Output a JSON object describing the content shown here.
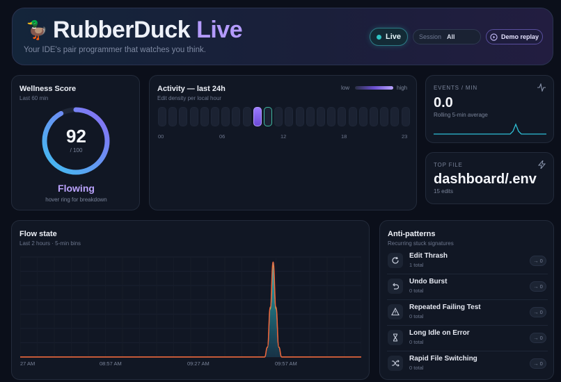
{
  "header": {
    "icon": "duck-emoji",
    "title_part1": "RubberDuck",
    "title_part2": "Live",
    "tagline": "Your IDE's pair programmer that watches you think.",
    "live_label": "Live",
    "session_label": "Session",
    "session_value": "All",
    "demo_label": "Demo replay",
    "accent": "#b49bff",
    "live_color": "#2ec4c4"
  },
  "wellness": {
    "title": "Wellness Score",
    "subtitle": "Last 60 min",
    "score": "92",
    "max": "/ 100",
    "score_fraction": 0.92,
    "state": "Flowing",
    "hint": "hover ring for breakdown"
  },
  "activity": {
    "title": "Activity — last 24h",
    "subtitle": "Edit density per local hour",
    "legend_low": "low",
    "legend_high": "high",
    "hour_labels": [
      "00",
      "06",
      "12",
      "18",
      "23"
    ],
    "hot_hours": [
      9
    ],
    "current_hour": 10
  },
  "events": {
    "label": "EVENTS / MIN",
    "value": "0.0",
    "subtitle": "Rolling 5-min average",
    "icon": "pulse-icon"
  },
  "topfile": {
    "label": "TOP FILE",
    "name": "dashboard/.env",
    "edits": "15 edits",
    "icon": "bolt-icon"
  },
  "flow": {
    "title": "Flow state",
    "subtitle": "Last 2 hours · 5-min bins",
    "x_ticks": [
      "27 AM",
      "08:57 AM",
      "09:27 AM",
      "09:57 AM"
    ]
  },
  "chart_data": {
    "type": "area",
    "title": "Flow state",
    "subtitle": "Last 2 hours · 5-min bins",
    "x_tick_labels": [
      "27 AM",
      "08:57 AM",
      "09:27 AM",
      "09:57 AM"
    ],
    "series": [
      {
        "color": "#f0643c",
        "values": [
          0,
          0,
          0,
          0,
          0,
          0,
          0,
          0,
          0,
          0,
          0,
          0,
          0,
          0,
          0,
          0,
          0,
          0,
          0,
          0,
          0,
          0,
          0,
          0,
          0,
          0,
          0,
          0,
          0,
          0,
          0,
          0,
          0,
          0,
          0,
          0,
          0,
          0,
          0,
          0,
          0,
          0,
          0,
          0,
          0,
          0,
          0,
          0,
          0,
          0,
          0,
          0,
          0,
          0,
          0,
          0,
          0,
          0,
          0,
          0,
          0,
          0,
          0,
          0,
          0,
          0,
          0,
          0,
          0,
          0,
          0,
          0,
          0,
          0,
          0,
          0,
          0,
          0,
          0,
          0,
          0,
          0,
          0,
          0,
          0,
          0,
          0,
          0.1,
          0.5,
          0.95,
          0.5,
          0.1,
          0,
          0,
          0,
          0,
          0,
          0,
          0,
          0,
          0,
          0,
          0,
          0,
          0,
          0,
          0,
          0,
          0,
          0,
          0,
          0,
          0,
          0,
          0,
          0,
          0,
          0,
          0,
          0,
          0
        ]
      }
    ],
    "grid": true
  },
  "anti": {
    "title": "Anti-patterns",
    "subtitle": "Recurring stuck signatures",
    "badge_arrow": "→",
    "items": [
      {
        "name": "Edit Thrash",
        "total": "1 total",
        "count": "0",
        "icon": "refresh-icon"
      },
      {
        "name": "Undo Burst",
        "total": "0 total",
        "count": "0",
        "icon": "undo-icon"
      },
      {
        "name": "Repeated Failing Test",
        "total": "0 total",
        "count": "0",
        "icon": "warning-icon"
      },
      {
        "name": "Long Idle on Error",
        "total": "0 total",
        "count": "0",
        "icon": "hourglass-icon"
      },
      {
        "name": "Rapid File Switching",
        "total": "0 total",
        "count": "0",
        "icon": "shuffle-icon"
      }
    ]
  }
}
